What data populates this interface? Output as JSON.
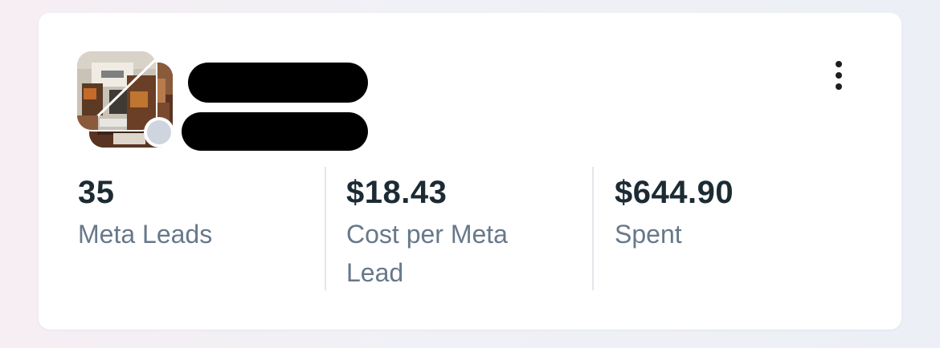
{
  "card": {
    "avatar": {
      "status_color": "#cfd5df"
    },
    "menu_icon": "more-vertical-icon",
    "metrics": [
      {
        "value": "35",
        "label": "Meta Leads"
      },
      {
        "value": "$18.43",
        "label": "Cost per Meta Lead"
      },
      {
        "value": "$644.90",
        "label": "Spent"
      }
    ]
  },
  "colors": {
    "value_text": "#1c2b33",
    "label_text": "#67788a",
    "divider": "#e4e6eb"
  }
}
